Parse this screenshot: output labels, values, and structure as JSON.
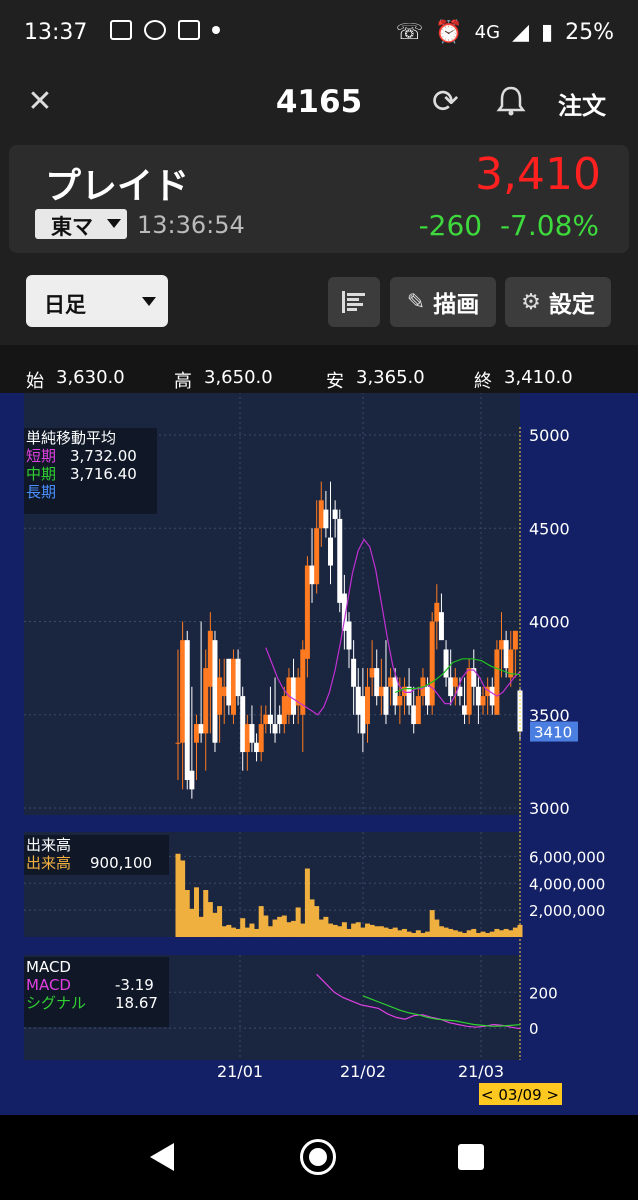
{
  "status_bar": {
    "time": "13:37",
    "network": "4G",
    "battery": "25%"
  },
  "header": {
    "stock_code": "4165",
    "order_label": "注文"
  },
  "stock": {
    "name": "プレイド",
    "market": "東マ",
    "time": "13:36:54",
    "price": "3,410",
    "change": "-260",
    "change_pct": "-7.08%"
  },
  "toolbar": {
    "period": "日足",
    "draw_label": "描画",
    "settings_label": "設定"
  },
  "ohlc": {
    "open_label": "始",
    "open": "3,630.0",
    "high_label": "高",
    "high": "3,650.0",
    "low_label": "安",
    "low": "3,365.0",
    "close_label": "終",
    "close": "3,410.0"
  },
  "colors": {
    "up": "#ff7a20",
    "down": "#ffffff",
    "short_ma": "#c030d0",
    "mid_ma": "#20c020",
    "long_ma": "#4a90ff",
    "chart_bg": "#142066",
    "panel_bg": "#1a2540"
  },
  "chart_data": [
    {
      "type": "candlestick",
      "title": "単純移動平均",
      "legend": [
        {
          "name": "短期",
          "value": "3,732.00",
          "color": "#e040e0"
        },
        {
          "name": "中期",
          "value": "3,716.40",
          "color": "#30d030"
        },
        {
          "name": "長期",
          "value": "",
          "color": "#4a90ff"
        }
      ],
      "ylim": [
        3000,
        5000
      ],
      "yticks": [
        3000,
        3500,
        4000,
        4500,
        5000
      ],
      "xticks": [
        "21/01",
        "21/02",
        "21/03"
      ],
      "current_price_label": "3410",
      "date_label": "< 03/09 >",
      "candles": [
        [
          3350,
          3850,
          3150,
          3350
        ],
        [
          3350,
          4000,
          3100,
          3900
        ],
        [
          3900,
          3950,
          3100,
          3150
        ],
        [
          3200,
          3650,
          3050,
          3100
        ],
        [
          3350,
          3500,
          3150,
          3450
        ],
        [
          3450,
          4000,
          3350,
          3400
        ],
        [
          3400,
          3850,
          3200,
          3750
        ],
        [
          3650,
          4050,
          3400,
          3950
        ],
        [
          3900,
          3950,
          3300,
          3350
        ],
        [
          3500,
          3800,
          3350,
          3700
        ],
        [
          3600,
          3800,
          3450,
          3650
        ],
        [
          3800,
          3750,
          3500,
          3550
        ],
        [
          3500,
          3850,
          3450,
          3800
        ],
        [
          3800,
          3850,
          3550,
          3600
        ],
        [
          3600,
          3650,
          3200,
          3300
        ],
        [
          3300,
          3500,
          3200,
          3450
        ],
        [
          3450,
          3550,
          3300,
          3350
        ],
        [
          3350,
          3400,
          3250,
          3300
        ],
        [
          3300,
          3550,
          3250,
          3450
        ],
        [
          3450,
          3550,
          3400,
          3500
        ],
        [
          3500,
          3650,
          3400,
          3450
        ],
        [
          3450,
          3700,
          3350,
          3400
        ],
        [
          3500,
          3550,
          3400,
          3450
        ],
        [
          3450,
          3650,
          3400,
          3600
        ],
        [
          3500,
          3750,
          3450,
          3700
        ],
        [
          3700,
          3800,
          3450,
          3500
        ],
        [
          3550,
          3750,
          3450,
          3700
        ],
        [
          3500,
          3900,
          3300,
          3850
        ],
        [
          3800,
          4350,
          3700,
          4300
        ],
        [
          4300,
          4500,
          4100,
          4200
        ],
        [
          4200,
          4650,
          4150,
          4500
        ],
        [
          4500,
          4750,
          4400,
          4650
        ],
        [
          4600,
          4700,
          4450,
          4500
        ],
        [
          4450,
          4750,
          4200,
          4300
        ],
        [
          4600,
          4650,
          4450,
          4550
        ],
        [
          4550,
          4600,
          4050,
          4100
        ],
        [
          4150,
          4250,
          3850,
          3950
        ],
        [
          4000,
          4050,
          3750,
          3850
        ],
        [
          3800,
          3900,
          3500,
          3650
        ],
        [
          3650,
          3750,
          3400,
          3500
        ],
        [
          3600,
          3750,
          3300,
          3400
        ],
        [
          3450,
          3750,
          3350,
          3650
        ],
        [
          3700,
          3900,
          3600,
          3750
        ],
        [
          3750,
          3850,
          3550,
          3600
        ],
        [
          3600,
          3800,
          3500,
          3650
        ],
        [
          3650,
          3900,
          3450,
          3500
        ],
        [
          3650,
          3750,
          3550,
          3700
        ],
        [
          3700,
          3750,
          3500,
          3550
        ],
        [
          3550,
          3700,
          3450,
          3600
        ],
        [
          3600,
          3700,
          3500,
          3650
        ],
        [
          3650,
          3750,
          3500,
          3550
        ],
        [
          3550,
          3650,
          3400,
          3450
        ],
        [
          3450,
          3650,
          3450,
          3600
        ],
        [
          3600,
          3750,
          3550,
          3700
        ],
        [
          3650,
          3700,
          3500,
          3550
        ],
        [
          3550,
          4050,
          3500,
          4000
        ],
        [
          4000,
          4200,
          3850,
          4100
        ],
        [
          4050,
          4150,
          3950,
          3900
        ],
        [
          3850,
          3900,
          3650,
          3700
        ],
        [
          3700,
          3850,
          3550,
          3600
        ],
        [
          3650,
          3750,
          3550,
          3700
        ],
        [
          3650,
          3700,
          3550,
          3600
        ],
        [
          3550,
          3700,
          3450,
          3500
        ],
        [
          3500,
          3800,
          3450,
          3750
        ],
        [
          3750,
          3850,
          3550,
          3650
        ],
        [
          3650,
          3700,
          3450,
          3550
        ],
        [
          3550,
          3650,
          3500,
          3600
        ],
        [
          3600,
          3700,
          3500,
          3650
        ],
        [
          3650,
          3700,
          3500,
          3550
        ],
        [
          3500,
          3900,
          3500,
          3850
        ],
        [
          3850,
          4050,
          3700,
          3900
        ],
        [
          3900,
          3950,
          3700,
          3750
        ],
        [
          3700,
          3950,
          3650,
          3850
        ],
        [
          3850,
          3950,
          3700,
          3950
        ],
        [
          3630,
          3650,
          3365,
          3410
        ]
      ],
      "ma_short": [
        3860,
        3780,
        3700,
        3640,
        3600,
        3580,
        3560,
        3540,
        3520,
        3500,
        3540,
        3620,
        3740,
        3900,
        4080,
        4260,
        4380,
        4440,
        4400,
        4280,
        4100,
        3920,
        3760,
        3660,
        3620,
        3620,
        3640,
        3640,
        3660,
        3640,
        3600,
        3560,
        3560,
        3620,
        3700,
        3740,
        3740,
        3700,
        3640,
        3620,
        3600,
        3620,
        3660,
        3700,
        3732
      ],
      "ma_mid": [
        3620,
        3640,
        3640,
        3650,
        3680,
        3720,
        3780,
        3800,
        3800,
        3790,
        3760,
        3740,
        3720,
        3716
      ]
    },
    {
      "type": "bar",
      "title": "出来高",
      "legend": [
        {
          "name": "出来高",
          "value": "900,100"
        }
      ],
      "yticks": [
        "6,000,000",
        "4,000,000",
        "2,000,000"
      ],
      "ylim": [
        0,
        7000000
      ],
      "values": [
        6200000,
        5700000,
        3500000,
        2100000,
        3700000,
        1500000,
        3500000,
        2600000,
        1800000,
        2300000,
        800000,
        900000,
        700000,
        600000,
        1400000,
        700000,
        1000000,
        600000,
        2300000,
        1600000,
        800000,
        1300000,
        1500000,
        1600000,
        1100000,
        1200000,
        2200000,
        1000000,
        5100000,
        2800000,
        2300000,
        1300000,
        1500000,
        1000000,
        900000,
        800000,
        1100000,
        600000,
        1000000,
        1100000,
        700000,
        1000000,
        900000,
        800000,
        800000,
        700000,
        600000,
        700000,
        500000,
        600000,
        400000,
        300000,
        500000,
        300000,
        400000,
        2000000,
        1300000,
        800000,
        700000,
        600000,
        500000,
        400000,
        300000,
        500000,
        600000,
        300000,
        400000,
        300000,
        400000,
        600000,
        500000,
        600000,
        500000,
        700000,
        900000
      ]
    },
    {
      "type": "line",
      "title": "MACD",
      "legend": [
        {
          "name": "MACD",
          "value": "-3.19",
          "color": "#e040e0"
        },
        {
          "name": "シグナル",
          "value": "18.67",
          "color": "#30d030"
        }
      ],
      "yticks": [
        "200",
        "0"
      ],
      "ylim": [
        -150,
        380
      ],
      "macd": [
        300,
        250,
        200,
        170,
        150,
        130,
        120,
        110,
        80,
        60,
        50,
        70,
        75,
        60,
        50,
        30,
        20,
        10,
        5,
        10,
        20,
        15,
        5,
        -3
      ],
      "signal": [
        180,
        160,
        140,
        120,
        100,
        85,
        75,
        60,
        50,
        45,
        40,
        30,
        20,
        15,
        10,
        12,
        15,
        19
      ]
    }
  ],
  "colors_extra": {
    "price_tag": "#4a7ee0",
    "date_tag": "#ffc820"
  }
}
